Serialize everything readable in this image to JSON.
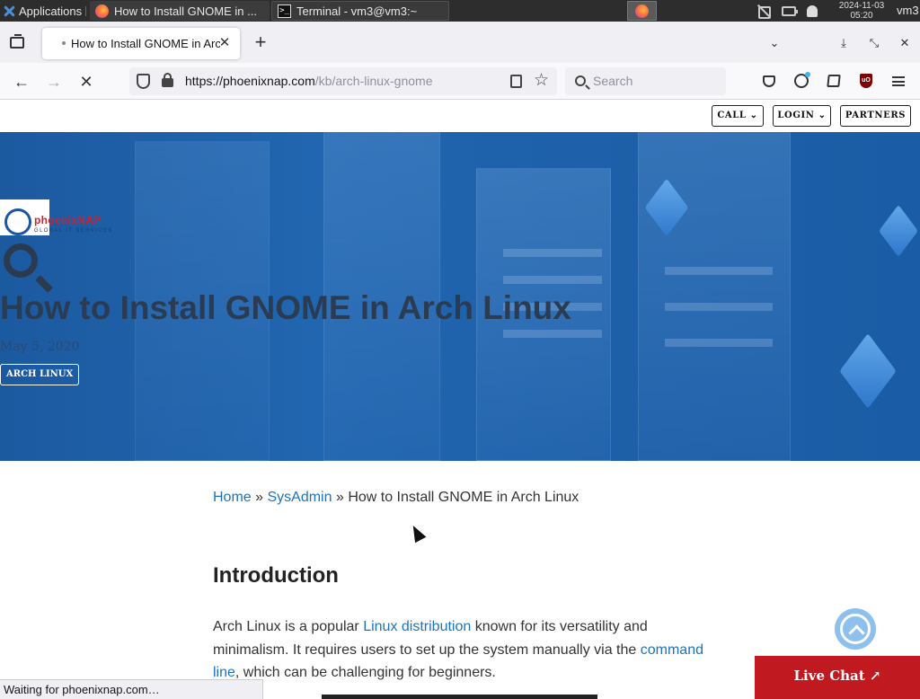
{
  "taskbar": {
    "apps_label": "Applications",
    "tasks": [
      {
        "label": "How to Install GNOME in ..."
      },
      {
        "label": "Terminal - vm3@vm3:~"
      }
    ],
    "clock_date": "2024-11-03",
    "clock_time": "05:20",
    "user": "vm3"
  },
  "browser": {
    "tab_title": "How to Install GNOME in Arch Linux",
    "new_tab": "+",
    "url_host": "https://phoenixnap.com",
    "url_path": "/kb/arch-linux-gnome",
    "search_placeholder": "Search",
    "status_text": "Waiting for phoenixnap.com…"
  },
  "site": {
    "topnav": {
      "call": "CALL ⌄",
      "login": "LOGIN ⌄",
      "partners": "PARTNERS"
    },
    "logo_name": "phoenixNAP",
    "logo_sub": "GLOBAL IT SERVICES",
    "title": "How to Install GNOME in Arch Linux",
    "date": "May 5, 2020",
    "tag": "ARCH LINUX"
  },
  "breadcrumb": {
    "home": "Home",
    "sep1": " » ",
    "section": "SysAdmin",
    "sep2": " » ",
    "current": "How to Install GNOME in Arch Linux"
  },
  "article": {
    "heading": "Introduction",
    "p1_a": "Arch Linux is a popular ",
    "p1_link1": "Linux distribution",
    "p1_b": " known for its versatility and minimalism. It requires users to set up the system manually via the ",
    "p1_link2": "command line",
    "p1_c": ", which can be challenging for beginners."
  },
  "live_chat": "Live Chat ↗"
}
